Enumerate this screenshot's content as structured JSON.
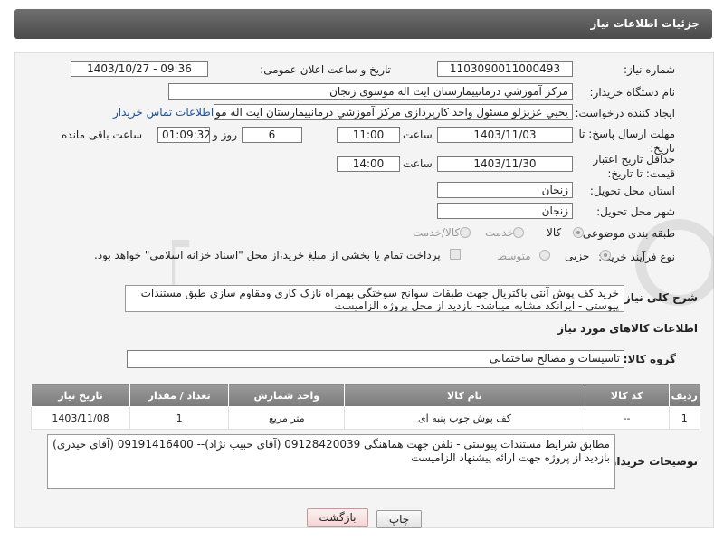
{
  "header": {
    "title": "جزئیات اطلاعات نیاز"
  },
  "form": {
    "need_number_label": "شماره نیاز:",
    "need_number": "1103090011000493",
    "announce_label": "تاریخ و ساعت اعلان عمومی:",
    "announce_value": "1403/10/27 - 09:36",
    "buyer_org_label": "نام دستگاه خریدار:",
    "buyer_org": "مرکز آموزشي درمانييمارستان ايت اله موسوی زنجان",
    "requester_label": "ایجاد کننده درخواست:",
    "requester": "يحيي عزيزلو مسئول واحد کارپردازی مرکز آموزشي درمانييمارستان ايت اله موسو",
    "contact_link": "اطلاعات تماس خریدار",
    "deadline_label": "مهلت ارسال پاسخ: تا تاریخ:",
    "deadline_date": "1403/11/03",
    "time_label": "ساعت",
    "deadline_time": "11:00",
    "days_value": "6",
    "days_label": "روز و",
    "remaining_time": "01:09:32",
    "remaining_label": "ساعت باقی مانده",
    "validity_label": "حداقل تاریخ اعتبار قیمت: تا تاریخ:",
    "validity_date": "1403/11/30",
    "validity_time": "14:00",
    "province_label": "استان محل تحویل:",
    "province": "زنجان",
    "city_label": "شهر محل تحویل:",
    "city": "زنجان",
    "category_label": "طبقه بندی موضوعی:",
    "category_options": [
      "کالا",
      "خدمت",
      "کالا/خدمت"
    ],
    "process_label": "نوع فرآیند خرید :",
    "process_options": [
      "جزیی",
      "متوسط"
    ],
    "payment_note": "پرداخت تمام یا بخشی از مبلغ خرید،از محل \"اسناد خزانه اسلامی\" خواهد بود."
  },
  "description": {
    "label": "شرح کلی نیاز:",
    "text": "خرید کف پوش  آنتی باکتریال جهت طبقات سوانح سوختگی بهمراه نازک کاری ومقاوم سازی طبق مستندات پیوستی - ایرانکد مشابه میباشد- بازدید از محل پروژه الزامیست"
  },
  "goods": {
    "section_title": "اطلاعات کالاهای مورد نیاز",
    "group_label": "گروه کالا:",
    "group_value": "تاسیسات و مصالح ساختمانی",
    "columns": [
      "ردیف",
      "کد کالا",
      "نام کالا",
      "واحد شمارش",
      "تعداد / مقدار",
      "تاریخ نیاز"
    ],
    "rows": [
      [
        "1",
        "--",
        "کف پوش چوب پنبه ای",
        "متر مربع",
        "1",
        "1403/11/08"
      ]
    ]
  },
  "buyer_notes": {
    "label": "توضیحات خریدار:",
    "line1": "مطابق شرایط مستندات پیوستی - تلفن جهت هماهنگی 09128420039 (آقای حبیب نژاد)-- 09191416400 (آقای حیدری)",
    "line2": "بازدید از پروژه جهت ارائه پیشنهاد الزامیست"
  },
  "buttons": {
    "print": "چاپ",
    "back": "بازگشت"
  },
  "colors": {
    "header_bg": "#5a5a5a",
    "table_header_bg": "#8a8a8a",
    "link": "#1a4fa0"
  }
}
